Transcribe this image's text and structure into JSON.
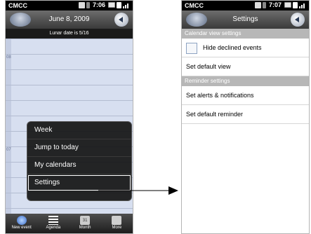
{
  "phone1": {
    "status": {
      "carrier": "CMCC",
      "time": "7:06"
    },
    "title": "June 8, 2009",
    "lunar": "Lunar date is 5/16",
    "hours": [
      "",
      "08",
      "",
      "",
      "",
      "",
      "",
      "07",
      "",
      "",
      "",
      ""
    ],
    "menu": [
      "Week",
      "Jump to today",
      "My calendars",
      "Settings"
    ],
    "bottom": [
      {
        "label": "New event",
        "icon": "plus-icon"
      },
      {
        "label": "Agenda",
        "icon": "list-icon"
      },
      {
        "label": "Month",
        "icon": "calendar-icon",
        "badge": "31"
      },
      {
        "label": "More",
        "icon": "more-icon"
      }
    ]
  },
  "phone2": {
    "status": {
      "carrier": "CMCC",
      "time": "7:07"
    },
    "title": "Settings",
    "sections": [
      {
        "header": "Calendar view settings",
        "rows": [
          "Hide declined events",
          "Set default view"
        ]
      },
      {
        "header": "Reminder settings",
        "rows": [
          "Set alerts & notifications",
          "Set default reminder"
        ]
      }
    ]
  }
}
